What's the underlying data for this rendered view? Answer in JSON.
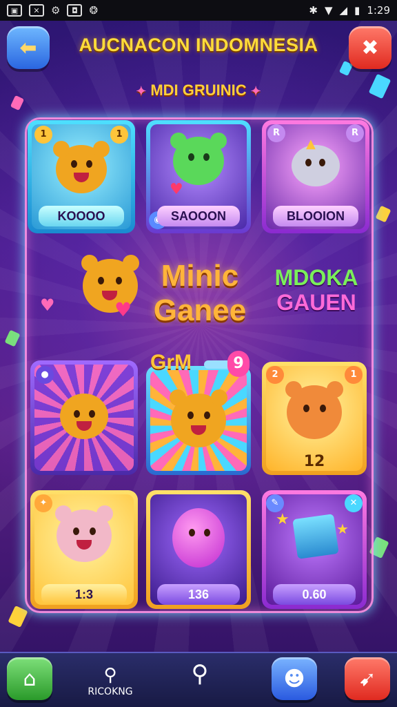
{
  "status_bar": {
    "time": "1:29"
  },
  "header": {
    "title": "AUCNACON INDOMNESIA",
    "subtitle": "MDI GRUINIC"
  },
  "grid": {
    "row1": [
      {
        "label": "KOOOO",
        "badge_left": "1",
        "badge_right": "1"
      },
      {
        "label": "SAOOON"
      },
      {
        "label": "BLOOION",
        "badge_left": "R",
        "badge_right": "R"
      }
    ],
    "middle": {
      "title_line1": "Minic",
      "title_line2": "Ganee",
      "side_line1": "MDOKA",
      "side_line2": "GAUEN"
    },
    "row2": [
      {
        "banner": "GrM",
        "banner_badge": "9"
      },
      {
        "label": "12",
        "badge_left": "2",
        "badge_right": "1"
      }
    ],
    "row3": [
      {
        "label": "1:3"
      },
      {
        "label": "136"
      },
      {
        "label": "0.60"
      }
    ]
  },
  "bottom_nav": {
    "search_label": "RICOKNG"
  },
  "colors": {
    "accent_gold": "#ffdc3a",
    "panel_glow": "#78dcff",
    "pink": "#ff6ab8"
  }
}
